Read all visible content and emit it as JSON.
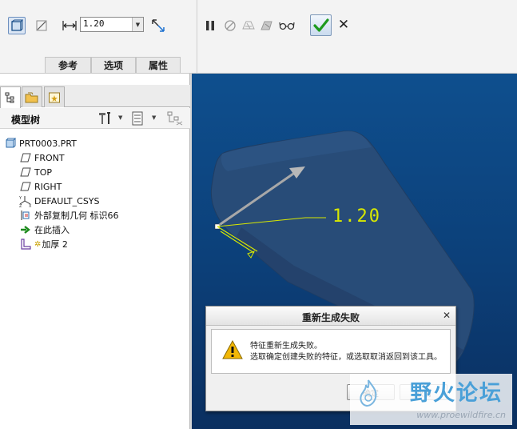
{
  "dashboard": {
    "thickness_value": "1.20",
    "tabs": [
      {
        "label": "参考"
      },
      {
        "label": "选项"
      },
      {
        "label": "属性"
      }
    ]
  },
  "navigator": {
    "tree_title": "模型树",
    "tree_items": [
      {
        "label": "PRT0003.PRT",
        "icon": "part-icon"
      },
      {
        "label": "FRONT",
        "icon": "datum-plane-icon"
      },
      {
        "label": "TOP",
        "icon": "datum-plane-icon"
      },
      {
        "label": "RIGHT",
        "icon": "datum-plane-icon"
      },
      {
        "label": "DEFAULT_CSYS",
        "icon": "csys-icon"
      },
      {
        "label": "外部复制几何 标识66",
        "icon": "copy-geom-icon"
      },
      {
        "label": "在此插入",
        "icon": "insert-here-arrow-icon"
      },
      {
        "label": "加厚 2",
        "icon": "thicken-icon"
      }
    ]
  },
  "graphics": {
    "dimension_label": "1.20",
    "colors": {
      "background_top": "#0e4f8e",
      "background_bottom": "#0a2f60",
      "part": "#294e7a",
      "dimension": "#d8e800"
    }
  },
  "dialog": {
    "title": "重新生成失败",
    "message_line1": "特征重新生成失败。",
    "message_line2": "选取确定创建失败的特征，或选取取消返回到该工具。",
    "ok_label": "确定",
    "cancel_label": "取消"
  },
  "watermark": {
    "text": "野火论坛",
    "url": "www.proewildfire.cn"
  }
}
